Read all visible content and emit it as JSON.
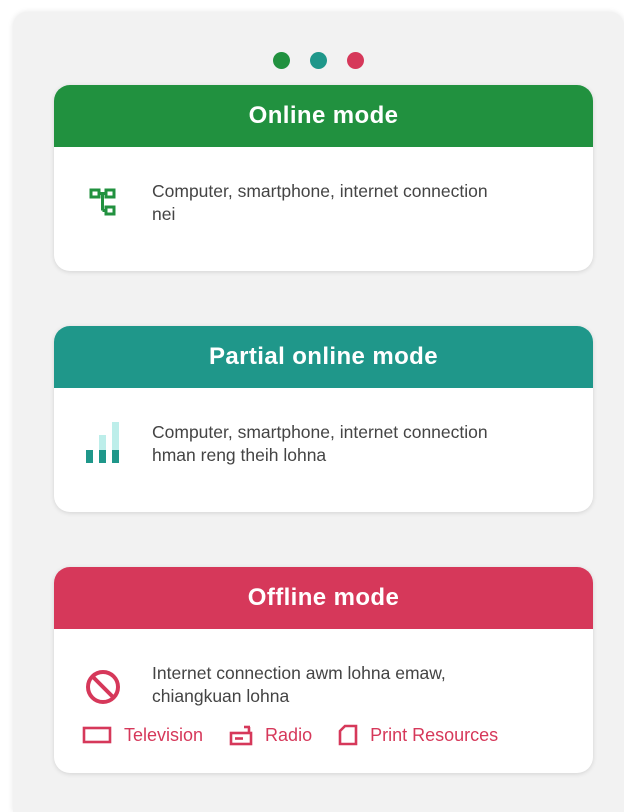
{
  "colors": {
    "green": "#21913f",
    "teal": "#1f978a",
    "red": "#d6385a",
    "light_teal": "#bdeeea"
  },
  "pager": {
    "dots": [
      "#21913f",
      "#1f978a",
      "#d6385a"
    ]
  },
  "cards": [
    {
      "title": "Online mode",
      "icon": "network-icon",
      "description": "Computer, smartphone, internet connection\nnei"
    },
    {
      "title": "Partial online mode",
      "icon": "signal-bars-icon",
      "description": "Computer, smartphone, internet connection\nhman reng theih lohna"
    },
    {
      "title": "Offline mode",
      "icon": "no-internet-icon",
      "description": "Internet connection awm lohna emaw,\nchiangkuan lohna",
      "media": [
        {
          "label": "Television",
          "icon": "television-icon"
        },
        {
          "label": "Radio",
          "icon": "radio-icon"
        },
        {
          "label": "Print Resources",
          "icon": "print-resources-icon"
        }
      ]
    }
  ]
}
